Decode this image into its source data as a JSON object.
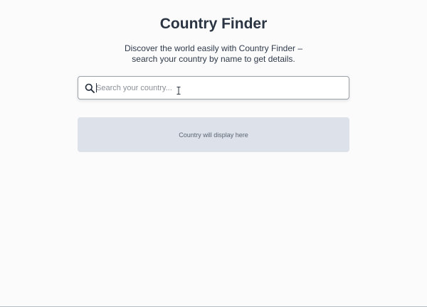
{
  "header": {
    "title": "Country Finder",
    "subtitle": "Discover the world easily with Country Finder – search your country by name to get details."
  },
  "search": {
    "icon": "search-icon",
    "placeholder": "Search your country...",
    "value": ""
  },
  "result": {
    "placeholder_text": "Country will display here"
  },
  "colors": {
    "background": "#fbfbfc",
    "title": "#2a3442",
    "result_panel": "#dde1ea",
    "result_text": "#5b6573"
  }
}
